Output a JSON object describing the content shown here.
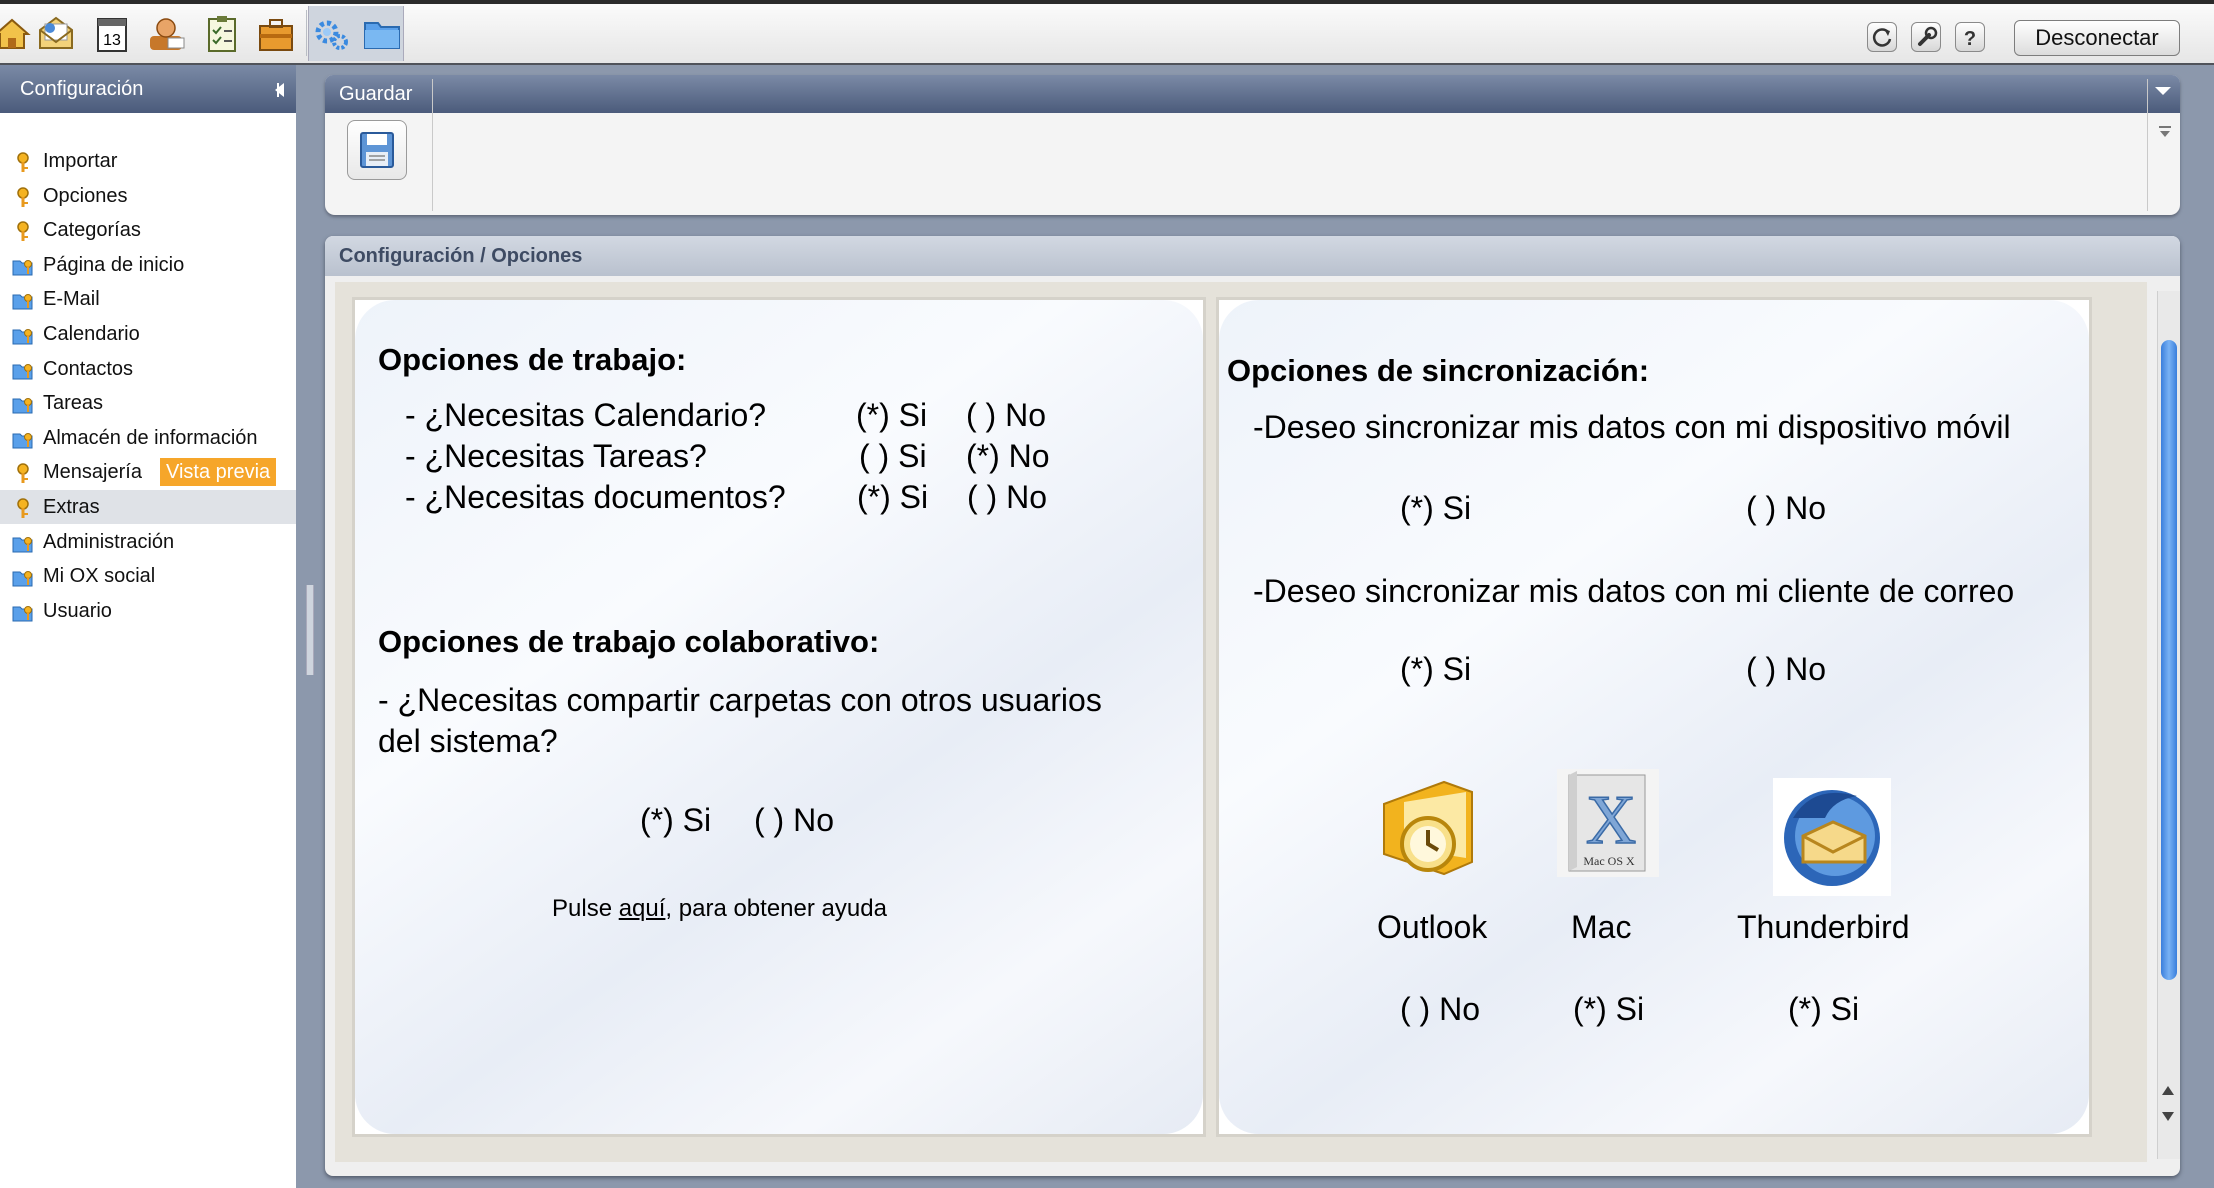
{
  "toolbar": {
    "apps": [
      "home-icon",
      "mail-icon",
      "calendar-icon",
      "contacts-icon",
      "tasks-icon",
      "infostore-icon",
      "settings-icon",
      "folder-icon"
    ],
    "calendar_day": "13",
    "logout_label": "Desconectar"
  },
  "sidebar": {
    "title": "Configuración",
    "items": [
      {
        "label": "Importar",
        "icon": "key-icon"
      },
      {
        "label": "Opciones",
        "icon": "key-icon"
      },
      {
        "label": "Categorías",
        "icon": "key-icon"
      },
      {
        "label": "Página de inicio",
        "icon": "folder-key-icon"
      },
      {
        "label": "E-Mail",
        "icon": "folder-key-icon"
      },
      {
        "label": "Calendario",
        "icon": "folder-key-icon"
      },
      {
        "label": "Contactos",
        "icon": "folder-key-icon"
      },
      {
        "label": "Tareas",
        "icon": "folder-key-icon"
      },
      {
        "label": "Almacén de información",
        "icon": "folder-key-icon"
      },
      {
        "label": "Mensajería",
        "icon": "key-icon",
        "badge": "Vista previa"
      },
      {
        "label": "Extras",
        "icon": "key-icon",
        "selected": true
      },
      {
        "label": "Administración",
        "icon": "folder-key-icon"
      },
      {
        "label": "Mi OX social",
        "icon": "folder-key-icon"
      },
      {
        "label": "Usuario",
        "icon": "folder-key-icon"
      }
    ]
  },
  "save_panel": {
    "title": "Guardar"
  },
  "content": {
    "breadcrumb": "Configuración / Opciones",
    "left_card": {
      "heading1": "Opciones de trabajo:",
      "questions": [
        {
          "q": "- ¿Necesitas Calendario?",
          "yes": "(*) Si",
          "no": "( ) No"
        },
        {
          "q": "- ¿Necesitas Tareas?",
          "yes": "( ) Si",
          "no": "(*) No"
        },
        {
          "q": "- ¿Necesitas documentos?",
          "yes": "(*) Si",
          "no": "( ) No"
        }
      ],
      "heading2": "Opciones de trabajo colaborativo:",
      "collab_line1": " - ¿Necesitas compartir carpetas con otros usuarios",
      "collab_line2": "del sistema?",
      "collab_yes": "(*) Si",
      "collab_no": "( ) No",
      "help_prefix": "Pulse ",
      "help_link": "aquí",
      "help_suffix": ", para obtener ayuda"
    },
    "right_card": {
      "heading": "Opciones de sincronización:",
      "mobile_q": "-Deseo sincronizar mis datos con mi dispositivo móvil",
      "mobile_yes": "(*) Si",
      "mobile_no": "( ) No",
      "mail_q": "-Deseo sincronizar mis datos con mi cliente de correo",
      "mail_yes": "(*) Si",
      "mail_no": "( ) No",
      "clients": [
        {
          "name": "Outlook",
          "icon": "outlook-icon",
          "choice": "( ) No"
        },
        {
          "name": "Mac",
          "icon": "mac-os-x-icon",
          "choice": "(*) Si",
          "icon_caption": "Mac OS X"
        },
        {
          "name": "Thunderbird",
          "icon": "thunderbird-icon",
          "choice": "(*) Si"
        }
      ]
    }
  },
  "colors": {
    "header_blue": "#5a6a88",
    "badge_orange": "#f6a62a",
    "scroll_blue": "#3a7fdc"
  }
}
